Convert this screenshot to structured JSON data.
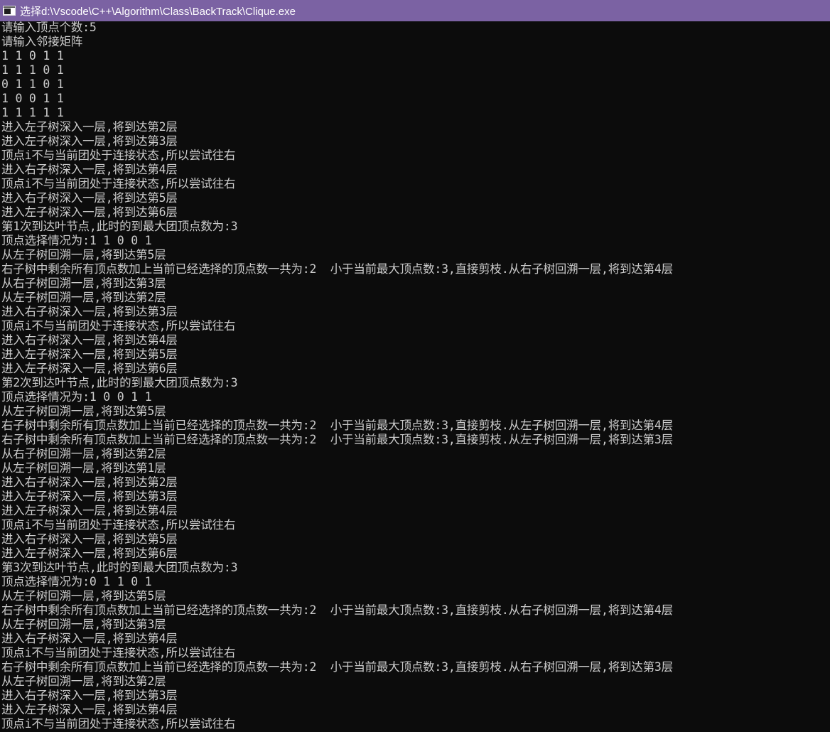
{
  "window": {
    "title": "选择d:\\Vscode\\C++\\Algorithm\\Class\\BackTrack\\Clique.exe",
    "icon": "console-app-icon",
    "colors": {
      "titlebar": "#7b62a3",
      "background": "#0c0c0c",
      "text": "#cccccc"
    }
  },
  "console": {
    "lines": [
      "请输入顶点个数:5",
      "请输入邻接矩阵",
      "1 1 0 1 1",
      "1 1 1 0 1",
      "0 1 1 0 1",
      "1 0 0 1 1",
      "1 1 1 1 1",
      "进入左子树深入一层,将到达第2层",
      "进入左子树深入一层,将到达第3层",
      "顶点i不与当前团处于连接状态,所以尝试往右",
      "进入右子树深入一层,将到达第4层",
      "顶点i不与当前团处于连接状态,所以尝试往右",
      "进入右子树深入一层,将到达第5层",
      "进入左子树深入一层,将到达第6层",
      "第1次到达叶节点,此时的到最大团顶点数为:3",
      "顶点选择情况为:1 1 0 0 1",
      "从左子树回溯一层,将到达第5层",
      "右子树中剩余所有顶点数加上当前已经选择的顶点数一共为:2  小于当前最大顶点数:3,直接剪枝.从右子树回溯一层,将到达第4层",
      "从右子树回溯一层,将到达第3层",
      "从左子树回溯一层,将到达第2层",
      "进入右子树深入一层,将到达第3层",
      "顶点i不与当前团处于连接状态,所以尝试往右",
      "进入右子树深入一层,将到达第4层",
      "进入左子树深入一层,将到达第5层",
      "进入左子树深入一层,将到达第6层",
      "第2次到达叶节点,此时的到最大团顶点数为:3",
      "顶点选择情况为:1 0 0 1 1",
      "从左子树回溯一层,将到达第5层",
      "右子树中剩余所有顶点数加上当前已经选择的顶点数一共为:2  小于当前最大顶点数:3,直接剪枝.从左子树回溯一层,将到达第4层",
      "右子树中剩余所有顶点数加上当前已经选择的顶点数一共为:2  小于当前最大顶点数:3,直接剪枝.从左子树回溯一层,将到达第3层",
      "从右子树回溯一层,将到达第2层",
      "从左子树回溯一层,将到达第1层",
      "进入右子树深入一层,将到达第2层",
      "进入左子树深入一层,将到达第3层",
      "进入左子树深入一层,将到达第4层",
      "顶点i不与当前团处于连接状态,所以尝试往右",
      "进入右子树深入一层,将到达第5层",
      "进入左子树深入一层,将到达第6层",
      "第3次到达叶节点,此时的到最大团顶点数为:3",
      "顶点选择情况为:0 1 1 0 1",
      "从左子树回溯一层,将到达第5层",
      "右子树中剩余所有顶点数加上当前已经选择的顶点数一共为:2  小于当前最大顶点数:3,直接剪枝.从右子树回溯一层,将到达第4层",
      "从左子树回溯一层,将到达第3层",
      "进入右子树深入一层,将到达第4层",
      "顶点i不与当前团处于连接状态,所以尝试往右",
      "右子树中剩余所有顶点数加上当前已经选择的顶点数一共为:2  小于当前最大顶点数:3,直接剪枝.从右子树回溯一层,将到达第3层",
      "从左子树回溯一层,将到达第2层",
      "进入右子树深入一层,将到达第3层",
      "进入左子树深入一层,将到达第4层",
      "顶点i不与当前团处于连接状态,所以尝试往右"
    ]
  }
}
